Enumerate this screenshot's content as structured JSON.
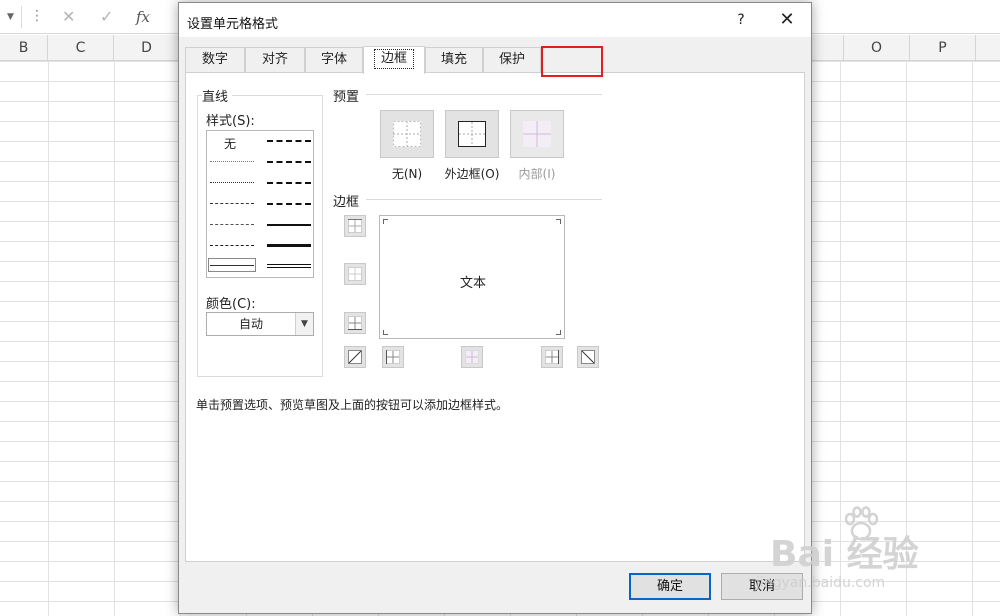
{
  "excel": {
    "formula_bar": {
      "cancel_icon": "✕",
      "confirm_icon": "✓",
      "fx_label": "fx"
    },
    "columns": [
      "B",
      "C",
      "D",
      "O",
      "P"
    ]
  },
  "dialog": {
    "title": "设置单元格格式",
    "help": "?",
    "close": "✕",
    "tabs": [
      {
        "label": "数字"
      },
      {
        "label": "对齐"
      },
      {
        "label": "字体"
      },
      {
        "label": "边框",
        "active": true
      },
      {
        "label": "填充"
      },
      {
        "label": "保护"
      }
    ],
    "line": {
      "group_label": "直线",
      "style_label": "样式(S):",
      "none_label": "无",
      "color_label": "颜色(C):",
      "color_value": "自动"
    },
    "presets": {
      "group_label": "预置",
      "items": [
        {
          "label": "无(N)"
        },
        {
          "label": "外边框(O)"
        },
        {
          "label": "内部(I)",
          "disabled": true
        }
      ]
    },
    "border": {
      "group_label": "边框",
      "preview_text": "文本"
    },
    "hint": "单击预置选项、预览草图及上面的按钮可以添加边框样式。",
    "ok_label": "确定",
    "cancel_label": "取消"
  },
  "watermark": {
    "brand": "Bai 经验",
    "url": "jingyan.baidu.com"
  },
  "colors": {
    "highlight": "#e51d1d",
    "ok_focus": "#0a64c8",
    "dialog_bg": "#f0f0f0"
  }
}
